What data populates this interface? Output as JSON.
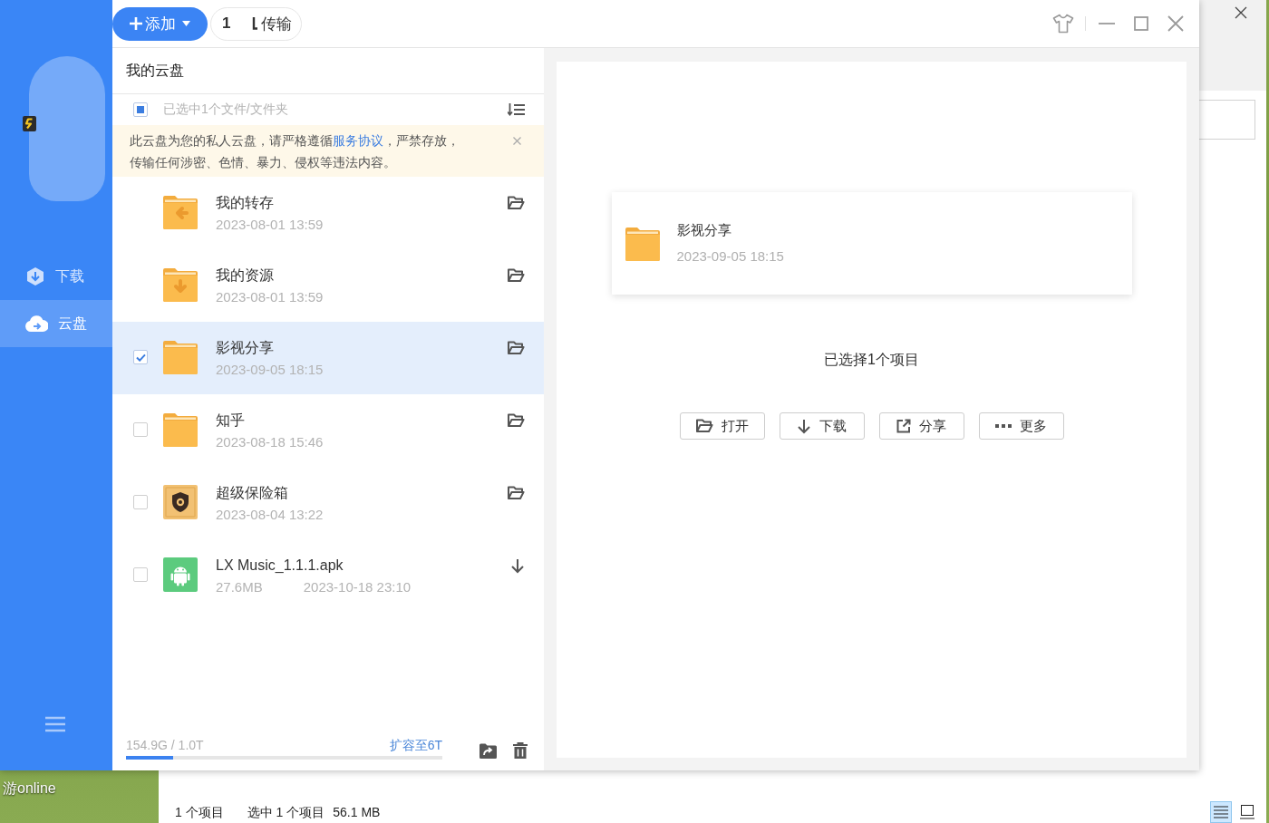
{
  "desktop": {
    "icon_label": "游online"
  },
  "explorer": {
    "status_bar": {
      "item_count": "1 个项目",
      "selection": "选中 1 个项目",
      "size": "56.1 MB"
    },
    "view_buttons": [
      {
        "kind": "details",
        "selected": true
      },
      {
        "kind": "large_icons",
        "selected": false
      }
    ]
  },
  "app": {
    "toolbar": {
      "add_button": "添加",
      "transfer": {
        "count": "1",
        "label": "传输"
      }
    },
    "sidebar": {
      "items": [
        {
          "kind": "download",
          "label": "下载",
          "selected": false
        },
        {
          "kind": "cloud",
          "label": "云盘",
          "selected": true
        }
      ]
    },
    "panel_title": "我的云盘",
    "selection_bar": {
      "indeterminate": true,
      "text": "已选中1个文件/文件夹"
    },
    "notice": {
      "text_before": "此云盘为您的私人云盘，请严格遵循",
      "link": "服务协议",
      "text_after": "，严禁存放，传输任何涉密、色情、暴力、侵权等违法内容。"
    },
    "files": [
      {
        "kind": "transfer_folder",
        "name": "我的转存",
        "date": "2023-08-01 13:59",
        "has_checkbox": false,
        "selected": false,
        "action": {
          "kind": "open"
        }
      },
      {
        "kind": "resource_folder",
        "name": "我的资源",
        "date": "2023-08-01 13:59",
        "has_checkbox": false,
        "selected": false,
        "action": {
          "kind": "open"
        }
      },
      {
        "kind": "folder",
        "name": "影视分享",
        "date": "2023-09-05 18:15",
        "has_checkbox": true,
        "selected": true,
        "action": {
          "kind": "open"
        }
      },
      {
        "kind": "folder",
        "name": "知乎",
        "date": "2023-08-18 15:46",
        "has_checkbox": true,
        "selected": false,
        "action": {
          "kind": "open"
        }
      },
      {
        "kind": "vault",
        "name": "超级保险箱",
        "date": "2023-08-04 13:22",
        "has_checkbox": true,
        "selected": false,
        "action": {
          "kind": "open"
        }
      },
      {
        "kind": "apk",
        "name": "LX Music_1.1.1.apk",
        "size": "27.6MB",
        "date": "2023-10-18 23:10",
        "has_checkbox": true,
        "selected": false,
        "action": {
          "kind": "download"
        }
      }
    ],
    "storage": {
      "usage": "154.9G / 1.0T",
      "level": 0.15,
      "upgrade_link": "扩容至6T"
    },
    "detail": {
      "item": {
        "kind": "folder",
        "name": "影视分享",
        "date": "2023-09-05 18:15"
      },
      "summary": "已选择1个项目",
      "actions": [
        {
          "kind": "open",
          "label": "打开"
        },
        {
          "kind": "download",
          "label": "下载"
        },
        {
          "kind": "share",
          "label": "分享"
        },
        {
          "kind": "more",
          "label": "更多"
        }
      ]
    }
  }
}
